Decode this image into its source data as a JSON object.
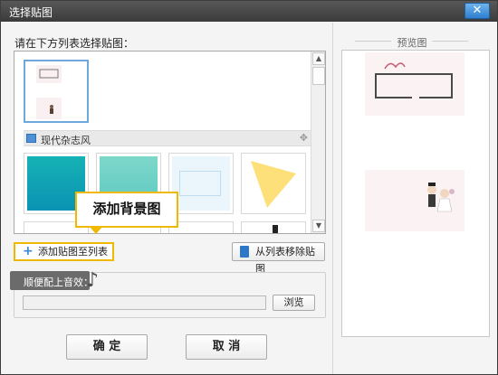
{
  "window": {
    "title": "选择贴图",
    "close_symbol": "✕"
  },
  "list_label": "请在下方列表选择贴图：",
  "category": {
    "label": "现代杂志风",
    "move_symbol": "✥"
  },
  "buttons": {
    "add": "添加贴图至列表",
    "remove": "从列表移除贴图",
    "browse": "浏览",
    "ok": "确 定",
    "cancel": "取 消"
  },
  "tooltip": "添加背景图",
  "sound": {
    "label": "顺便配上音效：",
    "file_value": ""
  },
  "preview": {
    "title": "预览图"
  },
  "colors": {
    "accent_border": "#f1b800",
    "titlebar": "#3b3b3b",
    "close_button": "#2f7fd0",
    "icon_blue": "#3a87d8",
    "thumb_teal_dark": "#0fa4b4",
    "thumb_teal_light": "#6fd0c6",
    "thumb_light_blue": "#e6f3fb",
    "thumb_yellow": "#fde37a"
  },
  "icons": {
    "add": "plus-icon",
    "remove": "trash-icon",
    "category": "picture-icon",
    "sound": "music-note-icon",
    "close": "close-icon"
  }
}
